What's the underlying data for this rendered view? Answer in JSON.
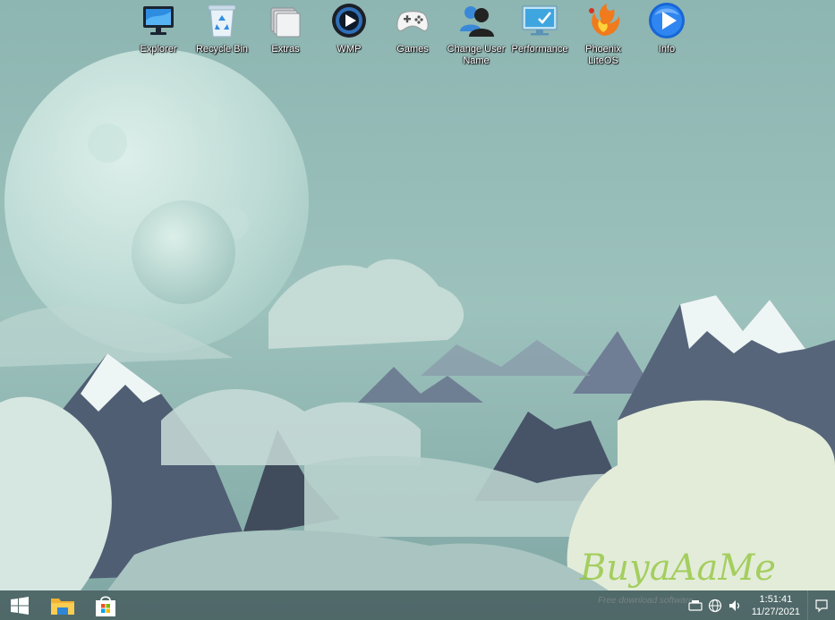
{
  "desktop_icons": [
    {
      "label": "Explorer",
      "icon": "monitor-icon"
    },
    {
      "label": "Recycle Bin",
      "icon": "recycle-bin-icon"
    },
    {
      "label": "Extras",
      "icon": "folders-icon"
    },
    {
      "label": "WMP",
      "icon": "media-player-icon"
    },
    {
      "label": "Games",
      "icon": "gamepad-icon"
    },
    {
      "label": "Change User Name",
      "icon": "users-icon"
    },
    {
      "label": "Performance",
      "icon": "performance-monitor-icon"
    },
    {
      "label": "Phoenix LiteOS",
      "icon": "phoenix-icon"
    },
    {
      "label": "Info",
      "icon": "play-info-icon"
    }
  ],
  "taskbar": {
    "pinned": [
      "windows-start-icon",
      "file-explorer-icon",
      "store-icon"
    ]
  },
  "tray": {
    "clock_time": "1:51:41",
    "clock_date": "11/27/2021"
  },
  "watermark": {
    "text": "BuyaAaMe",
    "subtext": "Free download software"
  },
  "colors": {
    "sky": "#8fb7b3",
    "moon": "#cfe8e2",
    "taskbar": "#2c3a3d",
    "mountain_dark": "#4f5e73",
    "snow": "#eef6f5",
    "cloud": "#d9e8e3"
  }
}
